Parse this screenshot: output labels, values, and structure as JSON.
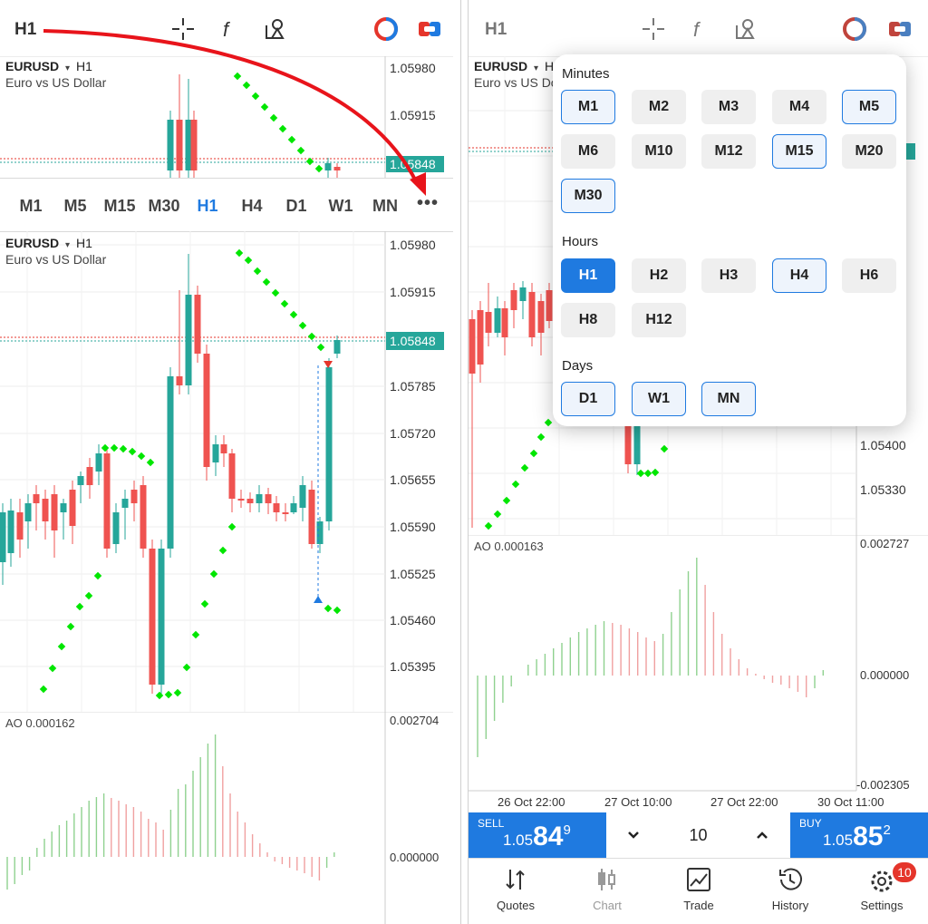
{
  "left": {
    "toolbar": {
      "timeframe": "H1"
    },
    "top_chart": {
      "symbol": "EURUSD",
      "timeframe": "H1",
      "description": "Euro vs US Dollar",
      "price_levels": [
        "1.05980",
        "1.05915"
      ],
      "current_price": "1.05848"
    },
    "timeframe_bar": {
      "items": [
        "M1",
        "M5",
        "M15",
        "M30",
        "H1",
        "H4",
        "D1",
        "W1",
        "MN"
      ],
      "active": "H1",
      "more": "•••"
    },
    "main_chart": {
      "symbol": "EURUSD",
      "timeframe": "H1",
      "description": "Euro vs US Dollar",
      "price_levels": [
        "1.05980",
        "1.05915",
        "1.05785",
        "1.05720",
        "1.05655",
        "1.05590",
        "1.05525",
        "1.05460",
        "1.05395"
      ],
      "current_price": "1.05848"
    },
    "ao": {
      "label": "AO 0.000162",
      "levels": [
        "0.002704",
        "0.000000"
      ]
    }
  },
  "right": {
    "toolbar": {
      "timeframe": "H1"
    },
    "chart": {
      "symbol": "EURUSD",
      "timeframe": "H",
      "description": "Euro vs US Dollar",
      "price_levels": [
        "1.05400",
        "1.05330"
      ],
      "time_labels": [
        "26 Oct 22:00",
        "27 Oct 10:00",
        "27 Oct 22:00",
        "30 Oct 11:00"
      ]
    },
    "ao": {
      "label": "AO 0.000163",
      "levels": [
        "0.002727",
        "0.000000",
        "-0.002305"
      ]
    },
    "timeframe_picker": {
      "minutes_title": "Minutes",
      "minutes": [
        {
          "label": "M1",
          "state": "outlined"
        },
        {
          "label": "M2",
          "state": "normal"
        },
        {
          "label": "M3",
          "state": "normal"
        },
        {
          "label": "M4",
          "state": "normal"
        },
        {
          "label": "M5",
          "state": "outlined"
        },
        {
          "label": "M6",
          "state": "normal"
        },
        {
          "label": "M10",
          "state": "normal"
        },
        {
          "label": "M12",
          "state": "normal"
        },
        {
          "label": "M15",
          "state": "outlined"
        },
        {
          "label": "M20",
          "state": "normal"
        },
        {
          "label": "M30",
          "state": "outlined"
        }
      ],
      "hours_title": "Hours",
      "hours": [
        {
          "label": "H1",
          "state": "selected"
        },
        {
          "label": "H2",
          "state": "normal"
        },
        {
          "label": "H3",
          "state": "normal"
        },
        {
          "label": "H4",
          "state": "outlined"
        },
        {
          "label": "H6",
          "state": "normal"
        },
        {
          "label": "H8",
          "state": "normal"
        },
        {
          "label": "H12",
          "state": "normal"
        }
      ],
      "days_title": "Days",
      "days": [
        {
          "label": "D1",
          "state": "outlined"
        },
        {
          "label": "W1",
          "state": "outlined"
        },
        {
          "label": "MN",
          "state": "outlined"
        }
      ]
    },
    "trade": {
      "sell_label": "SELL",
      "sell_price_small": "1.05",
      "sell_price_big": "84",
      "sell_price_sup": "9",
      "buy_label": "BUY",
      "buy_price_small": "1.05",
      "buy_price_big": "85",
      "buy_price_sup": "2",
      "quantity": "10"
    },
    "nav": [
      {
        "label": "Quotes",
        "icon": "quotes-arrows-icon"
      },
      {
        "label": "Chart",
        "icon": "candlestick-icon"
      },
      {
        "label": "Trade",
        "icon": "trade-chart-icon"
      },
      {
        "label": "History",
        "icon": "history-clock-icon"
      },
      {
        "label": "Settings",
        "icon": "gear-icon",
        "badge": "10"
      }
    ]
  },
  "colors": {
    "accent": "#1f7ae0",
    "bull": "#26a69a",
    "bear": "#ef5350",
    "psar": "#00e600",
    "annotation": "#e8141b"
  }
}
